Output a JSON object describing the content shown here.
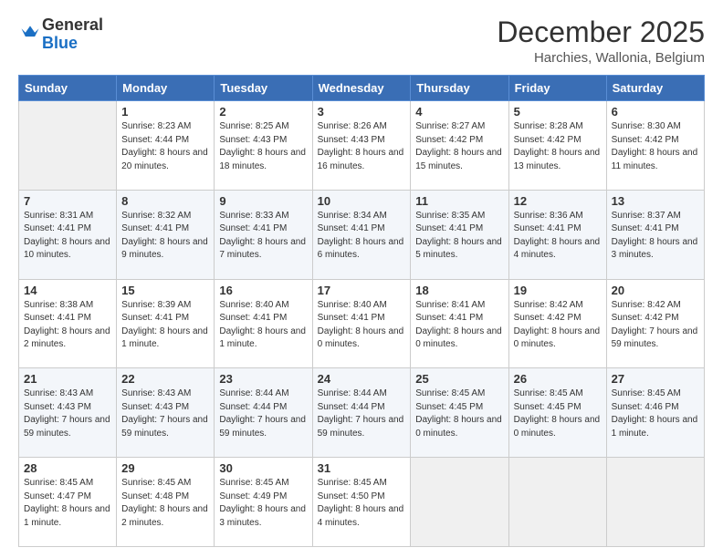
{
  "header": {
    "logo": {
      "general": "General",
      "blue": "Blue",
      "tagline": ""
    },
    "title": "December 2025",
    "location": "Harchies, Wallonia, Belgium"
  },
  "days_of_week": [
    "Sunday",
    "Monday",
    "Tuesday",
    "Wednesday",
    "Thursday",
    "Friday",
    "Saturday"
  ],
  "weeks": [
    [
      {
        "day": "",
        "sunrise": "",
        "sunset": "",
        "daylight": ""
      },
      {
        "day": "1",
        "sunrise": "Sunrise: 8:23 AM",
        "sunset": "Sunset: 4:44 PM",
        "daylight": "Daylight: 8 hours and 20 minutes."
      },
      {
        "day": "2",
        "sunrise": "Sunrise: 8:25 AM",
        "sunset": "Sunset: 4:43 PM",
        "daylight": "Daylight: 8 hours and 18 minutes."
      },
      {
        "day": "3",
        "sunrise": "Sunrise: 8:26 AM",
        "sunset": "Sunset: 4:43 PM",
        "daylight": "Daylight: 8 hours and 16 minutes."
      },
      {
        "day": "4",
        "sunrise": "Sunrise: 8:27 AM",
        "sunset": "Sunset: 4:42 PM",
        "daylight": "Daylight: 8 hours and 15 minutes."
      },
      {
        "day": "5",
        "sunrise": "Sunrise: 8:28 AM",
        "sunset": "Sunset: 4:42 PM",
        "daylight": "Daylight: 8 hours and 13 minutes."
      },
      {
        "day": "6",
        "sunrise": "Sunrise: 8:30 AM",
        "sunset": "Sunset: 4:42 PM",
        "daylight": "Daylight: 8 hours and 11 minutes."
      }
    ],
    [
      {
        "day": "7",
        "sunrise": "Sunrise: 8:31 AM",
        "sunset": "Sunset: 4:41 PM",
        "daylight": "Daylight: 8 hours and 10 minutes."
      },
      {
        "day": "8",
        "sunrise": "Sunrise: 8:32 AM",
        "sunset": "Sunset: 4:41 PM",
        "daylight": "Daylight: 8 hours and 9 minutes."
      },
      {
        "day": "9",
        "sunrise": "Sunrise: 8:33 AM",
        "sunset": "Sunset: 4:41 PM",
        "daylight": "Daylight: 8 hours and 7 minutes."
      },
      {
        "day": "10",
        "sunrise": "Sunrise: 8:34 AM",
        "sunset": "Sunset: 4:41 PM",
        "daylight": "Daylight: 8 hours and 6 minutes."
      },
      {
        "day": "11",
        "sunrise": "Sunrise: 8:35 AM",
        "sunset": "Sunset: 4:41 PM",
        "daylight": "Daylight: 8 hours and 5 minutes."
      },
      {
        "day": "12",
        "sunrise": "Sunrise: 8:36 AM",
        "sunset": "Sunset: 4:41 PM",
        "daylight": "Daylight: 8 hours and 4 minutes."
      },
      {
        "day": "13",
        "sunrise": "Sunrise: 8:37 AM",
        "sunset": "Sunset: 4:41 PM",
        "daylight": "Daylight: 8 hours and 3 minutes."
      }
    ],
    [
      {
        "day": "14",
        "sunrise": "Sunrise: 8:38 AM",
        "sunset": "Sunset: 4:41 PM",
        "daylight": "Daylight: 8 hours and 2 minutes."
      },
      {
        "day": "15",
        "sunrise": "Sunrise: 8:39 AM",
        "sunset": "Sunset: 4:41 PM",
        "daylight": "Daylight: 8 hours and 1 minute."
      },
      {
        "day": "16",
        "sunrise": "Sunrise: 8:40 AM",
        "sunset": "Sunset: 4:41 PM",
        "daylight": "Daylight: 8 hours and 1 minute."
      },
      {
        "day": "17",
        "sunrise": "Sunrise: 8:40 AM",
        "sunset": "Sunset: 4:41 PM",
        "daylight": "Daylight: 8 hours and 0 minutes."
      },
      {
        "day": "18",
        "sunrise": "Sunrise: 8:41 AM",
        "sunset": "Sunset: 4:41 PM",
        "daylight": "Daylight: 8 hours and 0 minutes."
      },
      {
        "day": "19",
        "sunrise": "Sunrise: 8:42 AM",
        "sunset": "Sunset: 4:42 PM",
        "daylight": "Daylight: 8 hours and 0 minutes."
      },
      {
        "day": "20",
        "sunrise": "Sunrise: 8:42 AM",
        "sunset": "Sunset: 4:42 PM",
        "daylight": "Daylight: 7 hours and 59 minutes."
      }
    ],
    [
      {
        "day": "21",
        "sunrise": "Sunrise: 8:43 AM",
        "sunset": "Sunset: 4:43 PM",
        "daylight": "Daylight: 7 hours and 59 minutes."
      },
      {
        "day": "22",
        "sunrise": "Sunrise: 8:43 AM",
        "sunset": "Sunset: 4:43 PM",
        "daylight": "Daylight: 7 hours and 59 minutes."
      },
      {
        "day": "23",
        "sunrise": "Sunrise: 8:44 AM",
        "sunset": "Sunset: 4:44 PM",
        "daylight": "Daylight: 7 hours and 59 minutes."
      },
      {
        "day": "24",
        "sunrise": "Sunrise: 8:44 AM",
        "sunset": "Sunset: 4:44 PM",
        "daylight": "Daylight: 7 hours and 59 minutes."
      },
      {
        "day": "25",
        "sunrise": "Sunrise: 8:45 AM",
        "sunset": "Sunset: 4:45 PM",
        "daylight": "Daylight: 8 hours and 0 minutes."
      },
      {
        "day": "26",
        "sunrise": "Sunrise: 8:45 AM",
        "sunset": "Sunset: 4:45 PM",
        "daylight": "Daylight: 8 hours and 0 minutes."
      },
      {
        "day": "27",
        "sunrise": "Sunrise: 8:45 AM",
        "sunset": "Sunset: 4:46 PM",
        "daylight": "Daylight: 8 hours and 1 minute."
      }
    ],
    [
      {
        "day": "28",
        "sunrise": "Sunrise: 8:45 AM",
        "sunset": "Sunset: 4:47 PM",
        "daylight": "Daylight: 8 hours and 1 minute."
      },
      {
        "day": "29",
        "sunrise": "Sunrise: 8:45 AM",
        "sunset": "Sunset: 4:48 PM",
        "daylight": "Daylight: 8 hours and 2 minutes."
      },
      {
        "day": "30",
        "sunrise": "Sunrise: 8:45 AM",
        "sunset": "Sunset: 4:49 PM",
        "daylight": "Daylight: 8 hours and 3 minutes."
      },
      {
        "day": "31",
        "sunrise": "Sunrise: 8:45 AM",
        "sunset": "Sunset: 4:50 PM",
        "daylight": "Daylight: 8 hours and 4 minutes."
      },
      {
        "day": "",
        "sunrise": "",
        "sunset": "",
        "daylight": ""
      },
      {
        "day": "",
        "sunrise": "",
        "sunset": "",
        "daylight": ""
      },
      {
        "day": "",
        "sunrise": "",
        "sunset": "",
        "daylight": ""
      }
    ]
  ]
}
